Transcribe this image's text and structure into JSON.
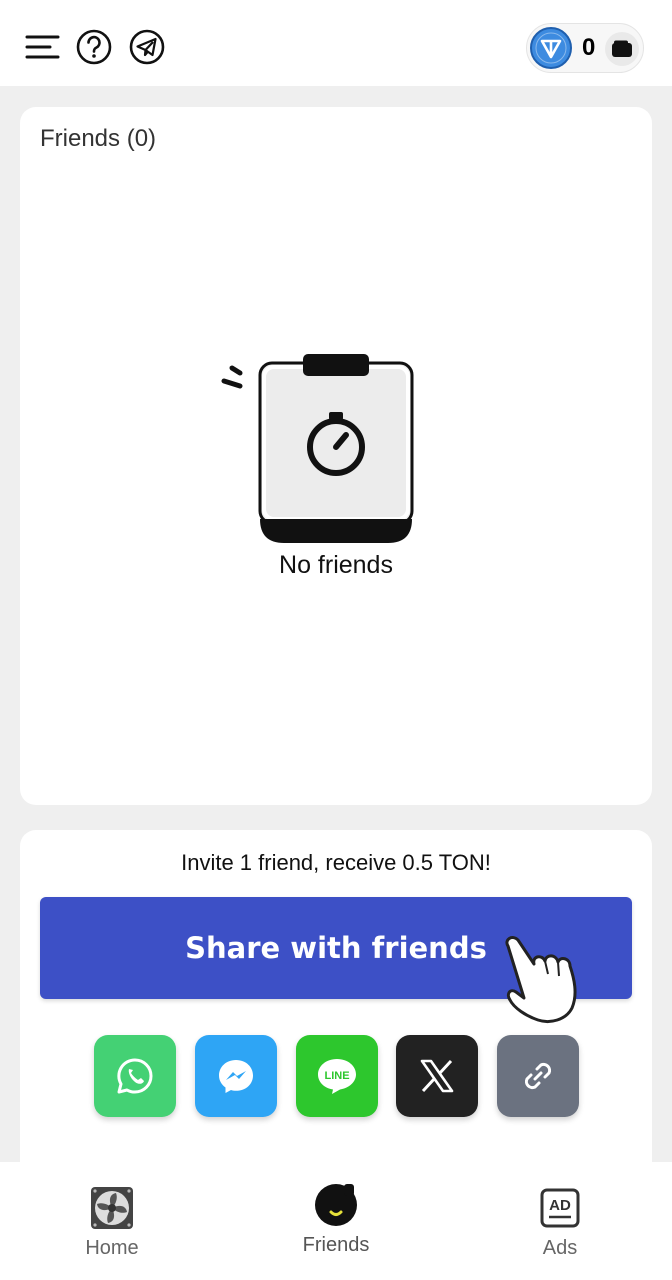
{
  "header": {
    "balance": "0",
    "icons": [
      "menu-icon",
      "help-icon",
      "telegram-icon",
      "ton-coin-icon",
      "wallet-icon"
    ],
    "ton_color": "#3d8be0"
  },
  "friends": {
    "title": "Friends (0)",
    "empty_text": "No friends"
  },
  "invite": {
    "text": "Invite 1 friend, receive 0.5 TON!",
    "share_label": "Share with friends",
    "share_color": "#3d50c6",
    "socials": [
      {
        "name": "whatsapp",
        "color": "#44d174"
      },
      {
        "name": "messenger",
        "color": "#2ea5f5"
      },
      {
        "name": "line",
        "color": "#2dc72d",
        "label": "LINE"
      },
      {
        "name": "x",
        "color": "#222222"
      },
      {
        "name": "link",
        "color": "#6b7280"
      }
    ]
  },
  "nav": {
    "items": [
      {
        "label": "Home",
        "icon": "fan-icon"
      },
      {
        "label": "Friends",
        "icon": "friend-face-icon"
      },
      {
        "label": "Ads",
        "icon": "ad-icon"
      }
    ]
  }
}
